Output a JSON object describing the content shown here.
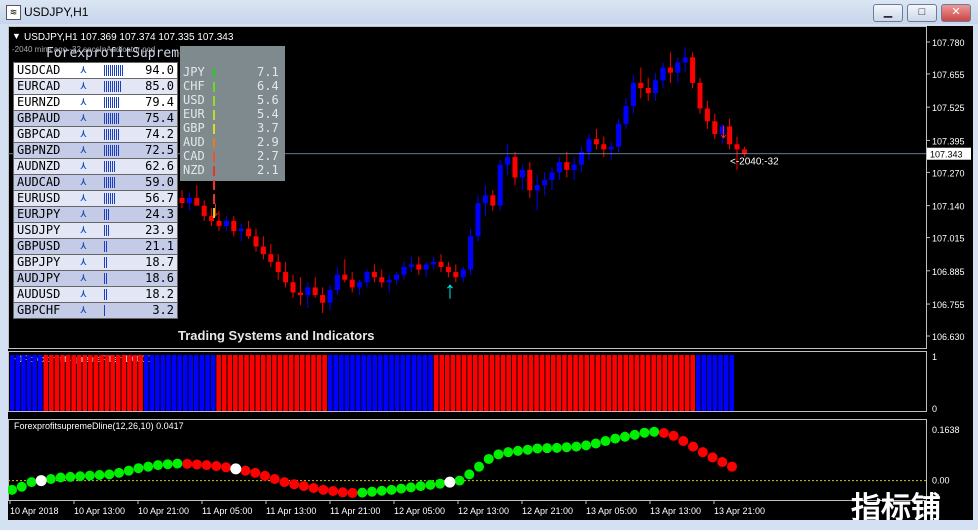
{
  "window": {
    "title": "USDJPY,H1"
  },
  "chart_header": {
    "symbol_line": "USDJPY,H1  107.369 107.374 107.335 107.343",
    "comment": "-2040 mins ago -32 secsInAudicator pcd"
  },
  "meter": {
    "title": "ForexprofitSupreme Meter",
    "pairs": [
      {
        "name": "USDCAD",
        "value": "94.0",
        "bars": 10,
        "bg": "#ffffff"
      },
      {
        "name": "EURCAD",
        "value": "85.0",
        "bars": 9,
        "bg": "#e3e7f5"
      },
      {
        "name": "EURNZD",
        "value": "79.4",
        "bars": 8,
        "bg": "#ffffff"
      },
      {
        "name": "GBPAUD",
        "value": "75.4",
        "bars": 8,
        "bg": "#c3cbe6"
      },
      {
        "name": "GBPCAD",
        "value": "74.2",
        "bars": 8,
        "bg": "#e3e7f5"
      },
      {
        "name": "GBPNZD",
        "value": "72.5",
        "bars": 8,
        "bg": "#c3cbe6"
      },
      {
        "name": "AUDNZD",
        "value": "62.6",
        "bars": 6,
        "bg": "#e3e7f5"
      },
      {
        "name": "AUDCAD",
        "value": "59.0",
        "bars": 6,
        "bg": "#c3cbe6"
      },
      {
        "name": "EURUSD",
        "value": "56.7",
        "bars": 6,
        "bg": "#e3e7f5"
      },
      {
        "name": "EURJPY",
        "value": "24.3",
        "bars": 3,
        "bg": "#c3cbe6"
      },
      {
        "name": "USDJPY",
        "value": "23.9",
        "bars": 3,
        "bg": "#e3e7f5"
      },
      {
        "name": "GBPUSD",
        "value": "21.1",
        "bars": 2,
        "bg": "#c3cbe6"
      },
      {
        "name": "GBPJPY",
        "value": "18.7",
        "bars": 2,
        "bg": "#e3e7f5"
      },
      {
        "name": "AUDJPY",
        "value": "18.6",
        "bars": 2,
        "bg": "#c3cbe6"
      },
      {
        "name": "AUDUSD",
        "value": "18.2",
        "bars": 2,
        "bg": "#e3e7f5"
      },
      {
        "name": "GBPCHF",
        "value": "3.2",
        "bars": 1,
        "bg": "#c3cbe6"
      }
    ],
    "currencies": [
      {
        "name": "JPY",
        "value": "7.1",
        "bars": 10,
        "color": "#22cc22"
      },
      {
        "name": "CHF",
        "value": "6.4",
        "bars": 9,
        "color": "#66dd22"
      },
      {
        "name": "USD",
        "value": "5.6",
        "bars": 8,
        "color": "#99dd22"
      },
      {
        "name": "EUR",
        "value": "5.4",
        "bars": 8,
        "color": "#bbdd22"
      },
      {
        "name": "GBP",
        "value": "3.7",
        "bars": 6,
        "color": "#dddd22"
      },
      {
        "name": "AUD",
        "value": "2.9",
        "bars": 4,
        "color": "#ee7722"
      },
      {
        "name": "CAD",
        "value": "2.7",
        "bars": 4,
        "color": "#ee5522"
      },
      {
        "name": "NZD",
        "value": "2.1",
        "bars": 3,
        "color": "#ee3322"
      }
    ]
  },
  "overlay_text": "Trading Systems and Indicators",
  "price_label": "<-2040:-32",
  "current_price": "107.343",
  "filter_label": "H1ForexprofitsupremeFilter 1.0000",
  "dline_label": "ForexprofitsupremeDline(12,26,10) 0.0417",
  "watermark": "指标铺",
  "chart_data": [
    {
      "type": "candlestick",
      "title": "USDJPY,H1",
      "y_ticks": [
        "107.780",
        "107.655",
        "107.525",
        "107.395",
        "107.270",
        "107.140",
        "107.015",
        "106.885",
        "106.755",
        "106.630"
      ],
      "ylim": [
        106.63,
        107.78
      ],
      "up_color": "#0000ff",
      "down_color": "#ff0000",
      "candles": [
        [
          107.17,
          107.2,
          107.13,
          107.15
        ],
        [
          107.15,
          107.19,
          107.12,
          107.17
        ],
        [
          107.17,
          107.22,
          107.14,
          107.14
        ],
        [
          107.14,
          107.16,
          107.08,
          107.1
        ],
        [
          107.1,
          107.13,
          107.06,
          107.08
        ],
        [
          107.08,
          107.12,
          107.04,
          107.06
        ],
        [
          107.06,
          107.1,
          107.04,
          107.08
        ],
        [
          107.08,
          107.1,
          107.02,
          107.04
        ],
        [
          107.04,
          107.07,
          107.0,
          107.05
        ],
        [
          107.05,
          107.08,
          107.01,
          107.02
        ],
        [
          107.02,
          107.05,
          106.96,
          106.98
        ],
        [
          106.98,
          107.02,
          106.93,
          106.95
        ],
        [
          106.95,
          106.99,
          106.9,
          106.92
        ],
        [
          106.92,
          106.95,
          106.85,
          106.88
        ],
        [
          106.88,
          106.92,
          106.82,
          106.84
        ],
        [
          106.84,
          106.87,
          106.78,
          106.8
        ],
        [
          106.8,
          106.86,
          106.75,
          106.79
        ],
        [
          106.79,
          106.84,
          106.74,
          106.82
        ],
        [
          106.82,
          106.86,
          106.78,
          106.79
        ],
        [
          106.79,
          106.82,
          106.72,
          106.76
        ],
        [
          106.76,
          106.83,
          106.73,
          106.81
        ],
        [
          106.81,
          106.9,
          106.79,
          106.87
        ],
        [
          106.87,
          106.93,
          106.84,
          106.85
        ],
        [
          106.85,
          106.88,
          106.8,
          106.82
        ],
        [
          106.82,
          106.85,
          106.79,
          106.84
        ],
        [
          106.84,
          106.89,
          106.82,
          106.88
        ],
        [
          106.88,
          106.91,
          106.84,
          106.86
        ],
        [
          106.86,
          106.89,
          106.82,
          106.84
        ],
        [
          106.84,
          106.87,
          106.8,
          106.85
        ],
        [
          106.85,
          106.88,
          106.83,
          106.87
        ],
        [
          106.87,
          106.92,
          106.85,
          106.9
        ],
        [
          106.9,
          106.94,
          106.88,
          106.91
        ],
        [
          106.91,
          106.94,
          106.87,
          106.89
        ],
        [
          106.89,
          106.92,
          106.86,
          106.91
        ],
        [
          106.91,
          106.94,
          106.89,
          106.92
        ],
        [
          106.92,
          106.95,
          106.88,
          106.9
        ],
        [
          106.9,
          106.92,
          106.86,
          106.88
        ],
        [
          106.88,
          106.91,
          106.84,
          106.86
        ],
        [
          106.86,
          106.9,
          106.84,
          106.89
        ],
        [
          106.89,
          107.05,
          106.87,
          107.02
        ],
        [
          107.02,
          107.18,
          107.0,
          107.15
        ],
        [
          107.15,
          107.22,
          107.1,
          107.18
        ],
        [
          107.18,
          107.2,
          107.12,
          107.14
        ],
        [
          107.14,
          107.32,
          107.12,
          107.3
        ],
        [
          107.3,
          107.38,
          107.26,
          107.33
        ],
        [
          107.33,
          107.35,
          107.22,
          107.25
        ],
        [
          107.25,
          107.3,
          107.2,
          107.28
        ],
        [
          107.28,
          107.31,
          107.17,
          107.2
        ],
        [
          107.2,
          107.26,
          107.12,
          107.22
        ],
        [
          107.22,
          107.27,
          107.18,
          107.24
        ],
        [
          107.24,
          107.29,
          107.2,
          107.27
        ],
        [
          107.27,
          107.33,
          107.24,
          107.31
        ],
        [
          107.31,
          107.35,
          107.25,
          107.28
        ],
        [
          107.28,
          107.33,
          107.24,
          107.3
        ],
        [
          107.3,
          107.37,
          107.27,
          107.35
        ],
        [
          107.35,
          107.42,
          107.32,
          107.4
        ],
        [
          107.4,
          107.44,
          107.36,
          107.38
        ],
        [
          107.38,
          107.41,
          107.33,
          107.36
        ],
        [
          107.36,
          107.39,
          107.32,
          107.37
        ],
        [
          107.37,
          107.48,
          107.35,
          107.46
        ],
        [
          107.46,
          107.56,
          107.44,
          107.53
        ],
        [
          107.53,
          107.65,
          107.5,
          107.62
        ],
        [
          107.62,
          107.68,
          107.56,
          107.6
        ],
        [
          107.6,
          107.64,
          107.55,
          107.58
        ],
        [
          107.58,
          107.66,
          107.55,
          107.63
        ],
        [
          107.63,
          107.7,
          107.6,
          107.68
        ],
        [
          107.68,
          107.74,
          107.62,
          107.66
        ],
        [
          107.66,
          107.72,
          107.62,
          107.7
        ],
        [
          107.7,
          107.76,
          107.66,
          107.72
        ],
        [
          107.72,
          107.74,
          107.6,
          107.62
        ],
        [
          107.62,
          107.64,
          107.5,
          107.52
        ],
        [
          107.52,
          107.55,
          107.44,
          107.47
        ],
        [
          107.47,
          107.5,
          107.4,
          107.42
        ],
        [
          107.42,
          107.46,
          107.38,
          107.45
        ],
        [
          107.45,
          107.48,
          107.36,
          107.38
        ],
        [
          107.38,
          107.41,
          107.28,
          107.36
        ],
        [
          107.36,
          107.37,
          107.33,
          107.343
        ]
      ]
    },
    {
      "type": "bar",
      "title": "H1ForexprofitsupremeFilter 1.0000",
      "y_ticks": [
        "1",
        "0"
      ],
      "ylim": [
        0,
        1
      ],
      "values": [
        1,
        1,
        1,
        1,
        1,
        1,
        0,
        0,
        0,
        0,
        0,
        0,
        0,
        0,
        0,
        0,
        0,
        0,
        0,
        0,
        0,
        0,
        0,
        0,
        1,
        1,
        1,
        1,
        1,
        1,
        1,
        1,
        1,
        1,
        1,
        1,
        1,
        0,
        0,
        0,
        0,
        0,
        0,
        0,
        0,
        0,
        0,
        0,
        0,
        0,
        0,
        0,
        0,
        0,
        0,
        0,
        0,
        1,
        1,
        1,
        1,
        1,
        1,
        1,
        1,
        1,
        1,
        1,
        1,
        1,
        1,
        1,
        1,
        1,
        1,
        1,
        0,
        0,
        0,
        0,
        0,
        0,
        0,
        0,
        0,
        0,
        0,
        0,
        0,
        0,
        0,
        0,
        0,
        0,
        0,
        0,
        0,
        0,
        0,
        0,
        0,
        0,
        0,
        0,
        0,
        0,
        0,
        0,
        0,
        0,
        0,
        0,
        0,
        0,
        0,
        0,
        0,
        0,
        0,
        0,
        0,
        0,
        0,
        1,
        1,
        1,
        1,
        1,
        1,
        1
      ],
      "colors": {
        "up": "#0000ff",
        "down": "#ff0000"
      }
    },
    {
      "type": "line",
      "title": "ForexprofitsupremeDline(12,26,10) 0.0417",
      "y_ticks": [
        "0.1638",
        "0.00"
      ],
      "ylim": [
        -0.05,
        0.18
      ],
      "values": [
        -0.03,
        -0.02,
        -0.005,
        0.0,
        0.005,
        0.01,
        0.012,
        0.014,
        0.016,
        0.018,
        0.02,
        0.025,
        0.032,
        0.04,
        0.045,
        0.05,
        0.053,
        0.055,
        0.054,
        0.052,
        0.05,
        0.047,
        0.043,
        0.038,
        0.032,
        0.025,
        0.015,
        0.005,
        -0.005,
        -0.012,
        -0.018,
        -0.024,
        -0.03,
        -0.034,
        -0.038,
        -0.04,
        -0.039,
        -0.036,
        -0.033,
        -0.03,
        -0.026,
        -0.022,
        -0.018,
        -0.014,
        -0.01,
        -0.005,
        0.0,
        0.02,
        0.045,
        0.07,
        0.085,
        0.092,
        0.096,
        0.1,
        0.104,
        0.105,
        0.106,
        0.108,
        0.11,
        0.114,
        0.12,
        0.128,
        0.136,
        0.142,
        0.148,
        0.155,
        0.158,
        0.154,
        0.145,
        0.128,
        0.11,
        0.092,
        0.075,
        0.06,
        0.045
      ],
      "colors": {
        "rising": "#00ee00",
        "falling": "#ff0000"
      }
    }
  ],
  "time_labels": [
    "10 Apr 2018",
    "10 Apr 13:00",
    "10 Apr 21:00",
    "11 Apr 05:00",
    "11 Apr 13:00",
    "11 Apr 21:00",
    "12 Apr 05:00",
    "12 Apr 13:00",
    "12 Apr 21:00",
    "13 Apr 05:00",
    "13 Apr 13:00",
    "13 Apr 21:00"
  ]
}
